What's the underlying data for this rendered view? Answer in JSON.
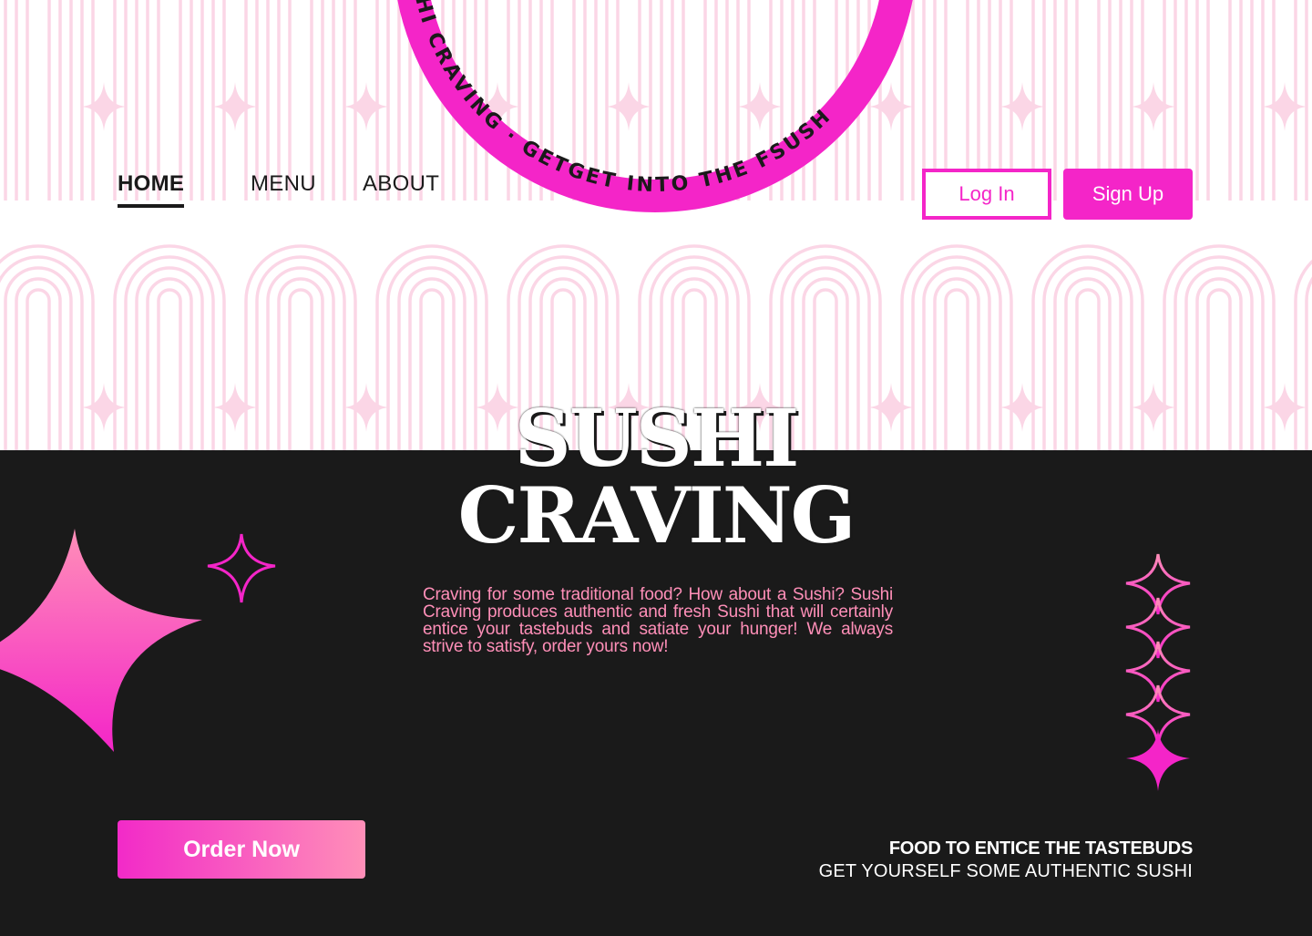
{
  "nav": {
    "home_label": "HOME",
    "menu_label": "MENU",
    "about_label": "ABOUT"
  },
  "auth": {
    "login_label": "Log In",
    "signup_label": "Sign Up"
  },
  "badge": {
    "ring_text": "SUSHI CRAVING · GETGET INTO THE FSUSH"
  },
  "hero": {
    "title_line1": "SUSHI",
    "title_line2": "CRAVING",
    "description": "Craving for some traditional food? How about a Sushi? Sushi Craving produces authentic and fresh Sushi that will certainly entice your tastebuds and satiate your hunger! We always strive to satisfy, order yours now!"
  },
  "cta": {
    "order_label": "Order Now"
  },
  "tagline": {
    "line1": "FOOD TO ENTICE THE TASTEBUDS",
    "line2": "GET YOURSELF SOME AUTHENTIC SUSHI"
  },
  "colors": {
    "accent": "#f425c8",
    "accent_light": "#ff8fb8",
    "dark": "#1a1a1a",
    "pattern": "#fbd6e6"
  },
  "icons": [
    "sparkle-icon",
    "sparkle-outline-icon",
    "sparkle-chain-icon"
  ]
}
